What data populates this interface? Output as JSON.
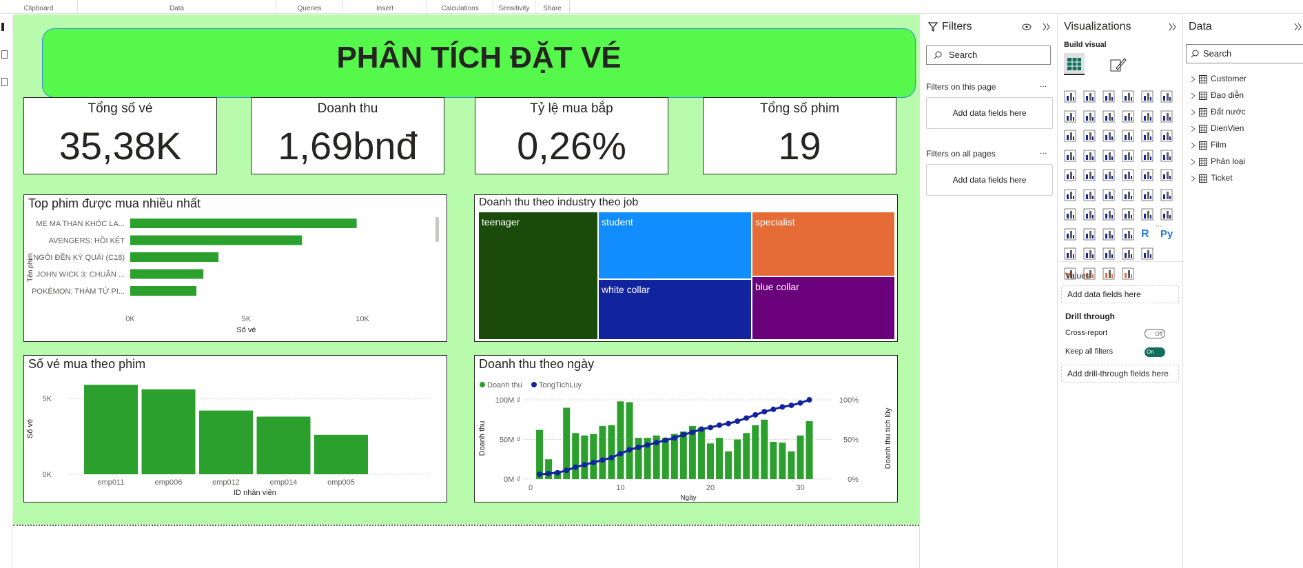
{
  "ribbon": {
    "groups": [
      "Clipboard",
      "Data",
      "Queries",
      "Insert",
      "Calculations",
      "Sensitivity",
      "Share"
    ]
  },
  "report": {
    "title": "PHÂN TÍCH ĐẶT VÉ",
    "cards": [
      {
        "label": "Tổng số vé",
        "value": "35,38K"
      },
      {
        "label": "Doanh thu",
        "value": "1,69bnđ"
      },
      {
        "label": "Tỷ lệ mua bắp",
        "value": "0,26%"
      },
      {
        "label": "Tổng số phim",
        "value": "19"
      }
    ],
    "top_movies": {
      "title": "Top phim được mua nhiều nhất"
    },
    "treemap": {
      "title": "Doanh thu theo industry theo job",
      "cells": [
        {
          "label": "teenager",
          "color": "#1b4b0a"
        },
        {
          "label": "student",
          "color": "#118dff"
        },
        {
          "label": "specialist",
          "color": "#e66c37"
        },
        {
          "label": "white collar",
          "color": "#12239e"
        },
        {
          "label": "blue collar",
          "color": "#6b007b"
        }
      ]
    },
    "tickets_by_employee": {
      "title": "Số vé mua theo phim"
    },
    "revenue_by_day": {
      "title": "Doanh thu theo ngày",
      "legend": [
        "Doanh thu",
        "TongTichLuy"
      ]
    }
  },
  "chart_data": [
    {
      "type": "bar",
      "orientation": "horizontal",
      "title": "Top phim được mua nhiều nhất",
      "categories": [
        "MẸ MA THAN KHÓC LA...",
        "AVENGERS: HỒI KẾT",
        "NGÔI ĐỀN KỲ QUÁI (C18)",
        "JOHN WICK 3: CHUẨN ...",
        "POKÉMON: THÁM TỬ PI..."
      ],
      "values": [
        9750,
        7400,
        3800,
        3150,
        2850
      ],
      "xlabel": "Số vé",
      "ylabel": "Tên phim",
      "xticks": [
        "0K",
        "5K",
        "10K"
      ],
      "xlim": [
        0,
        10000
      ],
      "color": "#2ca02c"
    },
    {
      "type": "bar",
      "title": "Số vé mua theo phim",
      "categories": [
        "emp011",
        "emp006",
        "emp012",
        "emp014",
        "emp005"
      ],
      "values": [
        5900,
        5600,
        4200,
        3800,
        2600
      ],
      "xlabel": "ID nhân viên",
      "ylabel": "Số vé",
      "yticks": [
        "0K",
        "5K"
      ],
      "ylim": [
        0,
        6000
      ],
      "color": "#2ca02c"
    },
    {
      "type": "bar",
      "title": "Doanh thu theo ngày",
      "x": [
        1,
        2,
        3,
        4,
        5,
        6,
        7,
        8,
        9,
        10,
        11,
        12,
        13,
        14,
        15,
        16,
        17,
        18,
        19,
        20,
        21,
        22,
        23,
        24,
        25,
        26,
        27,
        28,
        29,
        30,
        31
      ],
      "series": [
        {
          "name": "Doanh thu",
          "type": "bar",
          "axis": "left",
          "color": "#2ca02c",
          "values": [
            65,
            62,
            25,
            10,
            90,
            58,
            55,
            57,
            67,
            68,
            98,
            97,
            52,
            52,
            55,
            52,
            57,
            60,
            67,
            65,
            45,
            52,
            35,
            50,
            58,
            68,
            75,
            47,
            46,
            35,
            55,
            73
          ]
        },
        {
          "name": "TongTichLuy",
          "type": "line",
          "axis": "right",
          "color": "#12239e",
          "values": [
            4,
            6,
            7,
            8,
            11,
            15,
            18,
            21,
            24,
            27,
            32,
            37,
            40,
            43,
            46,
            49,
            52,
            56,
            59,
            63,
            65,
            68,
            70,
            73,
            77,
            81,
            85,
            88,
            91,
            93,
            96,
            100
          ]
        }
      ],
      "xlabel": "Ngày",
      "ylabel": "Doanh thu",
      "y2label": "Doanh thu tích lũy",
      "xticks": [
        0,
        10,
        20,
        30
      ],
      "yticks": [
        "0M ₫",
        "50M ₫",
        "100M ₫"
      ],
      "y2ticks": [
        "0%",
        "50%",
        "100%"
      ],
      "ylim": [
        0,
        100
      ],
      "y2lim": [
        0,
        100
      ]
    }
  ],
  "filters": {
    "title": "Filters",
    "search_placeholder": "Search",
    "on_page": "Filters on this page",
    "on_all": "Filters on all pages",
    "add": "Add data fields here",
    "dots": "..."
  },
  "visualizations": {
    "title": "Visualizations",
    "build": "Build visual",
    "values": "Values",
    "add_values": "Add data fields here",
    "drill": "Drill through",
    "cross": "Cross-report",
    "cross_state": "Off",
    "keep": "Keep all filters",
    "keep_state": "On",
    "add_drill": "Add drill-through fields here",
    "r_icon": "R",
    "py_icon": "Py",
    "more": "···"
  },
  "data": {
    "title": "Data",
    "search_placeholder": "Search",
    "tables": [
      "Customer",
      "Đạo diễn",
      "Đất nước",
      "DienVien",
      "Film",
      "Phân loại",
      "Ticket"
    ]
  }
}
